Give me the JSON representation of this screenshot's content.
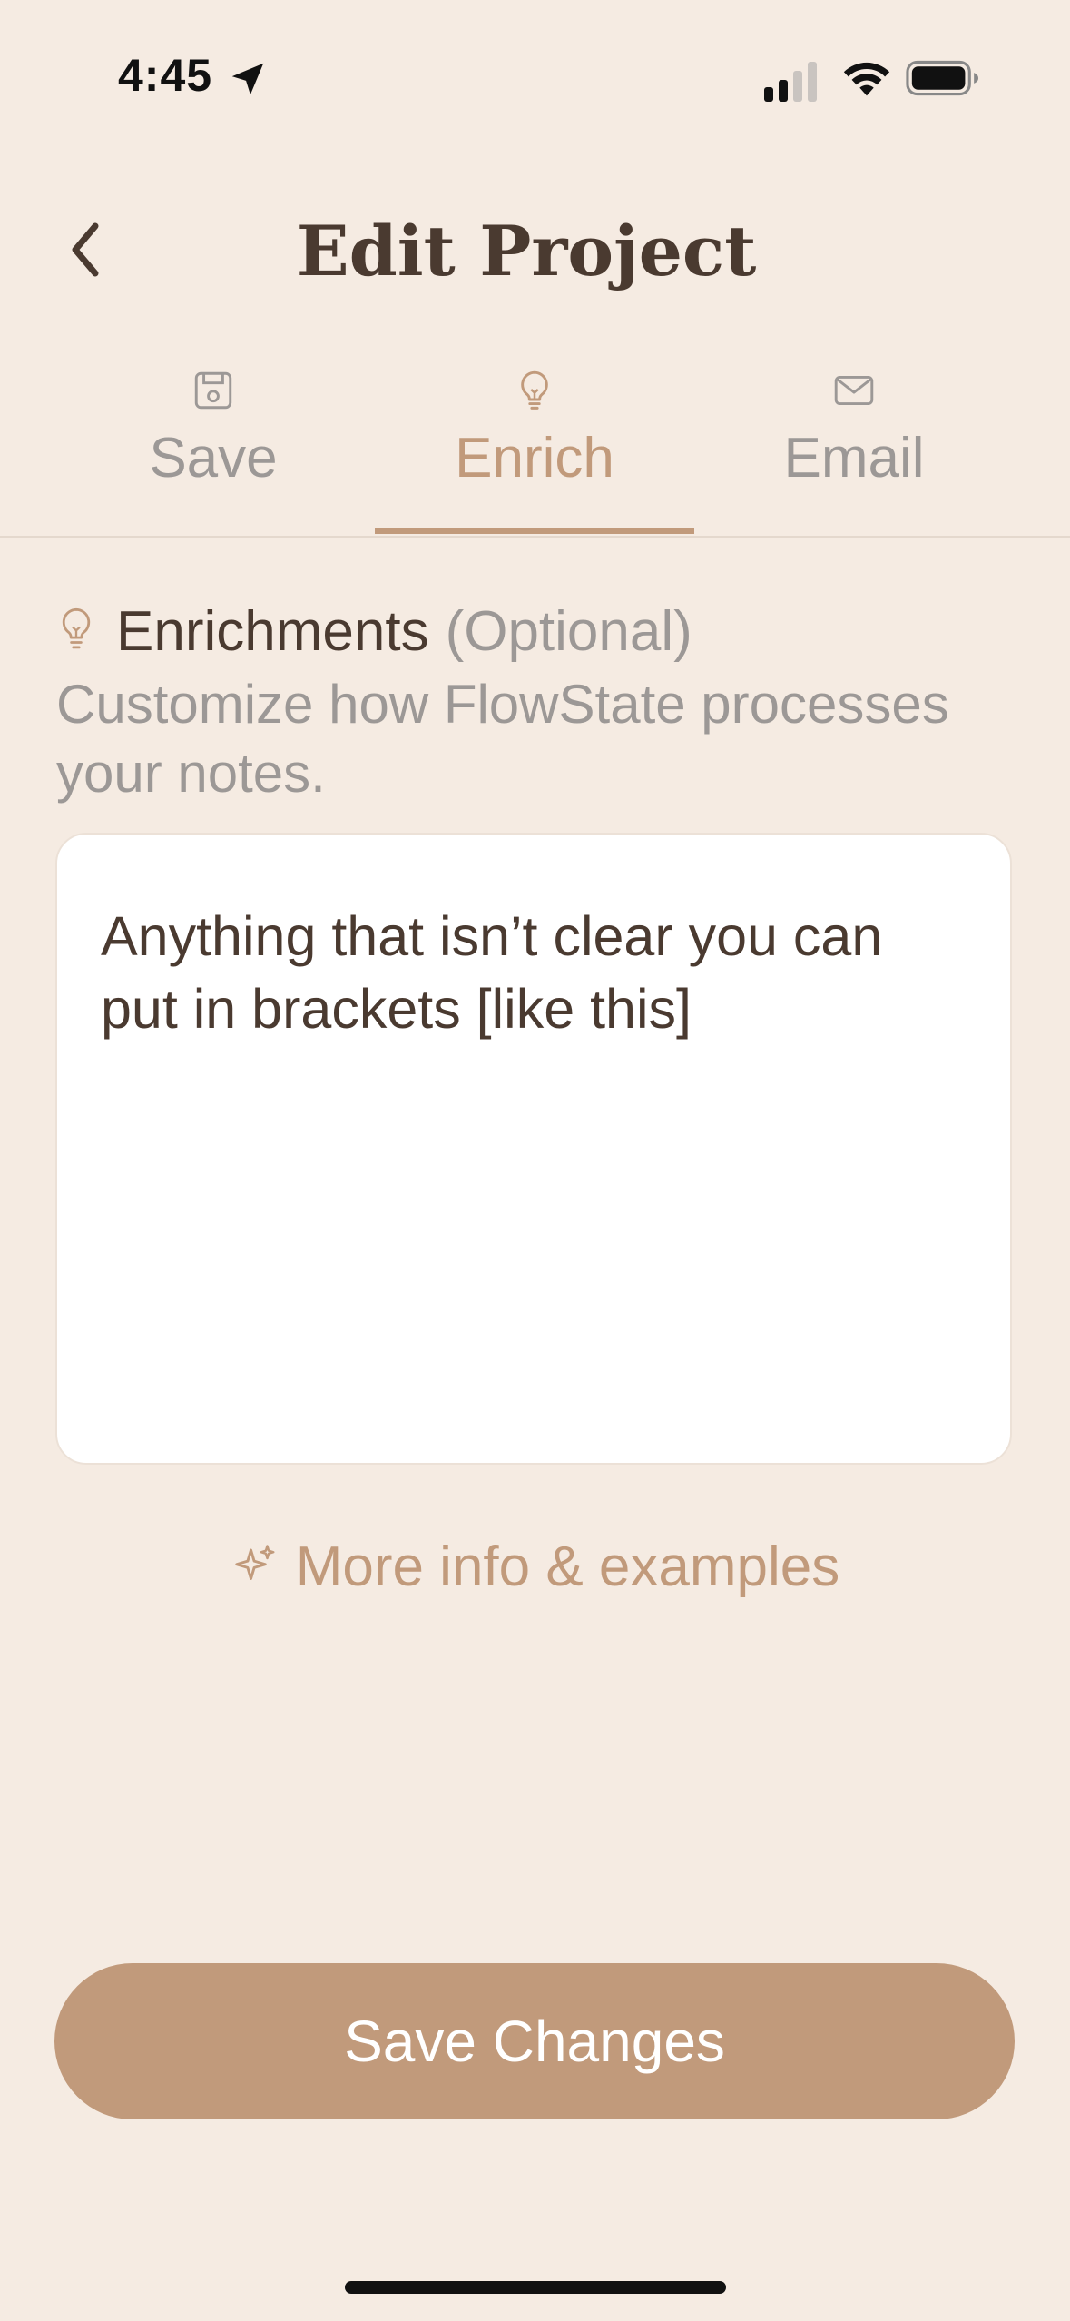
{
  "status_bar": {
    "time": "4:45",
    "icons": [
      "location-arrow-icon",
      "cellular-signal-icon",
      "wifi-icon",
      "battery-icon"
    ]
  },
  "header": {
    "back_icon": "chevron-left-icon",
    "title": "Edit Project"
  },
  "tabs": [
    {
      "label": "Save",
      "icon": "floppy-disk-icon",
      "active": false
    },
    {
      "label": "Enrich",
      "icon": "lightbulb-icon",
      "active": true
    },
    {
      "label": "Email",
      "icon": "envelope-icon",
      "active": false
    }
  ],
  "enrichments": {
    "icon": "lightbulb-icon",
    "title": "Enrichments",
    "optional": "(Optional)",
    "description": "Customize how FlowState processes your notes.",
    "input_value": "Anything that isn’t clear you can put in brackets [like this]"
  },
  "more_info": {
    "icon": "sparkle-icon",
    "label": "More info & examples"
  },
  "save_button": {
    "label": "Save Changes"
  },
  "colors": {
    "background": "#f5ebe2",
    "accent": "#c19a7b",
    "text_primary": "#4a3a30",
    "text_muted": "#9c9896",
    "input_background": "#ffffff"
  }
}
